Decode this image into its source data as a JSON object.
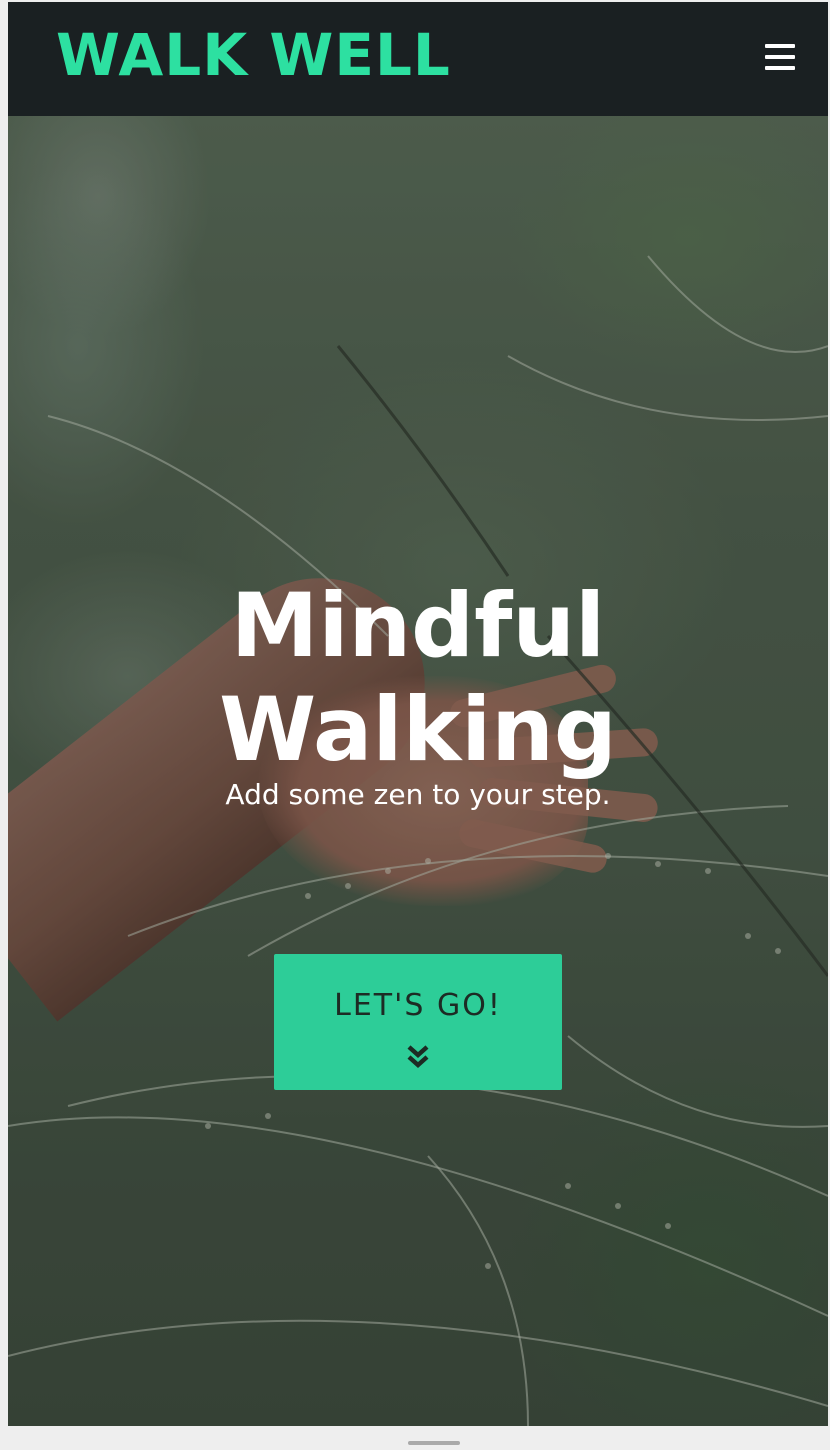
{
  "header": {
    "brand": "WALK WELL",
    "menu_icon": "hamburger-menu-icon",
    "background_color": "#1a2022",
    "brand_color": "#2de0a1"
  },
  "hero": {
    "title_line1": "Mindful",
    "title_line2": "Walking",
    "subtitle": "Add some zen to your step.",
    "background_image": "hand brushing through tall grass",
    "cta": {
      "label": "LET'S GO!",
      "icon": "double-chevron-down-icon",
      "color": "#2dcd98"
    }
  }
}
